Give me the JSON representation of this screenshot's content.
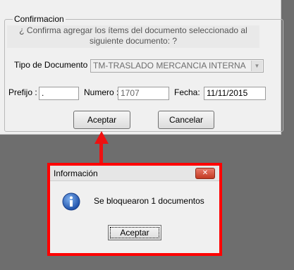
{
  "form": {
    "group_title": "Confirmacion",
    "question": "¿ Confirma agregar los ítems del documento seleccionado al siguiente documento: ?",
    "tipo_label": "Tipo de Documento :",
    "tipo_value": "TM-TRASLADO MERCANCIA INTERNA",
    "prefijo_label": "Prefijo :",
    "prefijo_value": ".",
    "numero_label": "Numero :",
    "numero_value": "1707",
    "fecha_label": "Fecha:",
    "fecha_value": "11/11/2015",
    "accept_label": "Aceptar",
    "cancel_label": "Cancelar"
  },
  "dialog": {
    "title": "Información",
    "message": "Se bloquearon 1 documentos",
    "accept_label": "Aceptar",
    "close_icon": "close-icon",
    "info_icon": "info-icon"
  },
  "colors": {
    "highlight": "#ff0000",
    "arrow": "#ee1111",
    "background": "#6e6e6e"
  }
}
